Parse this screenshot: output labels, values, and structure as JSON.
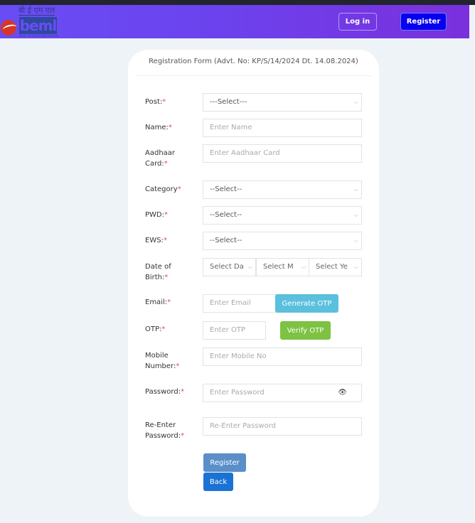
{
  "navbar": {
    "logo": {
      "hindi_text": "बी ई एम एल",
      "wordmark": "beml",
      "tagline": "BEML, TRUSTED, NEW GROUND"
    },
    "login_label": "Log in",
    "register_label": "Register"
  },
  "form": {
    "title": "Registration Form (Advt. No: KP/S/14/2024 Dt. 14.08.2024)",
    "required_marker": "*",
    "fields": {
      "post": {
        "label": "Post:",
        "value": "---Select---"
      },
      "name": {
        "label": "Name:",
        "placeholder": "Enter Name"
      },
      "aadhaar": {
        "label_line1": "Aadhaar",
        "label_line2": "Card:",
        "placeholder": "Enter Aadhaar Card"
      },
      "category": {
        "label": "Category",
        "value": "--Select--"
      },
      "pwd": {
        "label": "PWD:",
        "value": "--Select--"
      },
      "ews": {
        "label": "EWS:",
        "value": "--Select--"
      },
      "dob": {
        "label_line1": "Date of",
        "label_line2": "Birth:",
        "day": "Select Da",
        "month": "Select M",
        "year": "Select Ye"
      },
      "email": {
        "label": "Email:",
        "placeholder": "Enter Email",
        "button": "Generate OTP"
      },
      "otp": {
        "label": "OTP:",
        "placeholder": "Enter OTP",
        "button": "Verify OTP"
      },
      "mobile": {
        "label_line1": "Mobile",
        "label_line2": "Number:",
        "placeholder": "Enter Mobile No"
      },
      "password": {
        "label": "Password:",
        "placeholder": "Enter Password",
        "eye_icon": "👁"
      },
      "reenter": {
        "label_line1": "Re-Enter",
        "label_line2": "Password:",
        "placeholder": "Re-Enter Password"
      }
    },
    "register_label": "Register",
    "back_label": "Back",
    "chevron": "⌵"
  },
  "colors": {
    "nav_gradient_start": "#6a4cf5",
    "nav_gradient_end": "#7a30dc",
    "register_nav": "#0800f0",
    "generate_otp": "#5bc0de",
    "verify_otp": "#7dc242",
    "register_form": "#5a8fc8",
    "back": "#1a73d4"
  }
}
